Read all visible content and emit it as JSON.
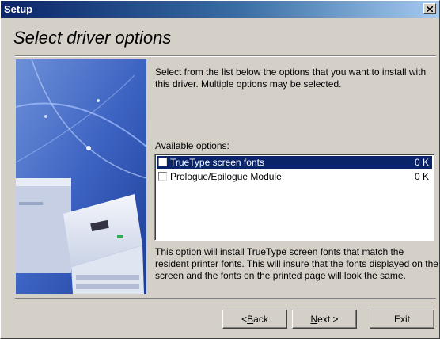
{
  "window": {
    "title": "Setup",
    "close_label": "×"
  },
  "heading": "Select driver options",
  "intro_text": "Select from the list below the options that you want to install with this driver. Multiple options may be selected.",
  "available_label": "Available options:",
  "options": [
    {
      "name": "TrueType screen fonts",
      "size": "0 K",
      "checked": false,
      "selected": true
    },
    {
      "name": "Prologue/Epilogue Module",
      "size": "0 K",
      "checked": false,
      "selected": false
    }
  ],
  "description": "This option will install TrueType screen fonts that match the resident printer fonts. This will insure that the fonts displayed on the screen and the fonts on the printed page will look the same.",
  "buttons": {
    "back_mnemonic": "B",
    "back_rest": "ack",
    "back_prefix": "< ",
    "next_mnemonic": "N",
    "next_rest": "ext >",
    "exit_label": "Exit"
  },
  "colors": {
    "titlebar_start": "#0a246a",
    "selection": "#0a246a",
    "dialog_bg": "#d4d0c8"
  },
  "icons": {
    "close": "close-icon",
    "side_art": "printer-illustration"
  }
}
